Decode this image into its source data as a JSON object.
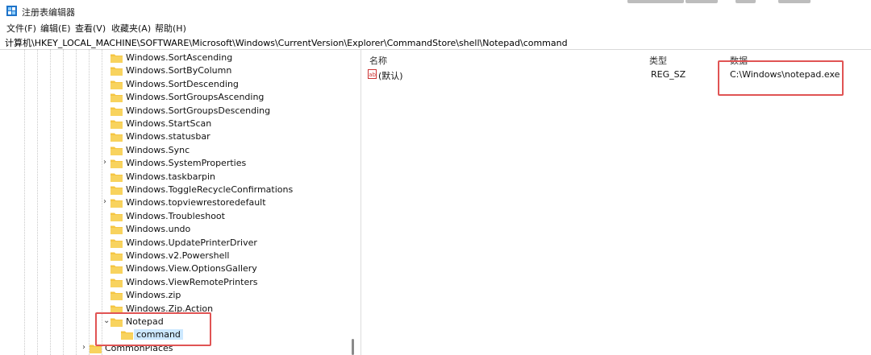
{
  "window": {
    "title": "注册表编辑器"
  },
  "menu": [
    "文件(F)",
    "编辑(E)",
    "查看(V)",
    "收藏夹(A)",
    "帮助(H)"
  ],
  "address": "计算机\\HKEY_LOCAL_MACHINE\\SOFTWARE\\Microsoft\\Windows\\CurrentVersion\\Explorer\\CommandStore\\shell\\Notepad\\command",
  "tree": [
    {
      "label": "Windows.SortAscending",
      "expandable": false
    },
    {
      "label": "Windows.SortByColumn",
      "expandable": false
    },
    {
      "label": "Windows.SortDescending",
      "expandable": false
    },
    {
      "label": "Windows.SortGroupsAscending",
      "expandable": false
    },
    {
      "label": "Windows.SortGroupsDescending",
      "expandable": false
    },
    {
      "label": "Windows.StartScan",
      "expandable": false
    },
    {
      "label": "Windows.statusbar",
      "expandable": false
    },
    {
      "label": "Windows.Sync",
      "expandable": false
    },
    {
      "label": "Windows.SystemProperties",
      "expandable": true
    },
    {
      "label": "Windows.taskbarpin",
      "expandable": false
    },
    {
      "label": "Windows.ToggleRecycleConfirmations",
      "expandable": false
    },
    {
      "label": "Windows.topviewrestoredefault",
      "expandable": true
    },
    {
      "label": "Windows.Troubleshoot",
      "expandable": false
    },
    {
      "label": "Windows.undo",
      "expandable": false
    },
    {
      "label": "Windows.UpdatePrinterDriver",
      "expandable": false
    },
    {
      "label": "Windows.v2.Powershell",
      "expandable": false
    },
    {
      "label": "Windows.View.OptionsGallery",
      "expandable": false
    },
    {
      "label": "Windows.ViewRemotePrinters",
      "expandable": false
    },
    {
      "label": "Windows.zip",
      "expandable": false
    },
    {
      "label": "Windows.Zip.Action",
      "expandable": false
    }
  ],
  "notepad": {
    "label": "Notepad",
    "child": "command"
  },
  "commonplaces": "CommonPlaces",
  "columns": {
    "name": "名称",
    "type": "类型",
    "data": "数据"
  },
  "values": [
    {
      "name": "(默认)",
      "type": "REG_SZ",
      "data": "C:\\Windows\\notepad.exe"
    }
  ],
  "colors": {
    "highlight": "#e05454",
    "selection": "#cce8ff",
    "folder": "#f5c542"
  }
}
